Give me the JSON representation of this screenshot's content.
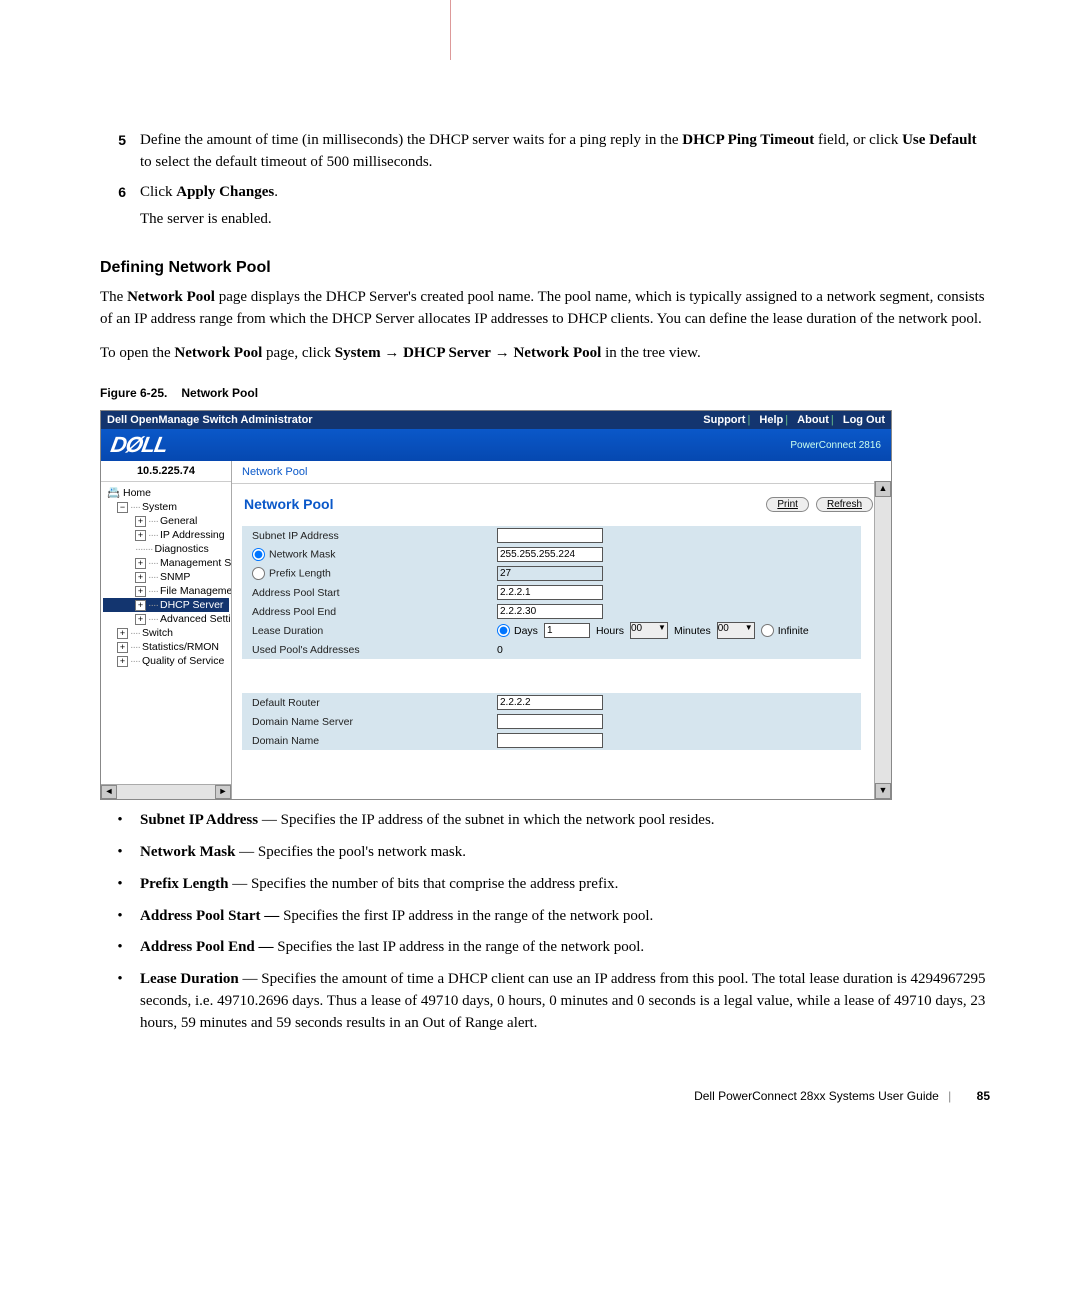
{
  "steps": {
    "s5": {
      "num": "5",
      "t1": "Define the amount of time (in milliseconds) the DHCP server waits for a ping reply in the ",
      "b1": "DHCP Ping Timeout",
      "t2": " field, or click ",
      "b2": "Use Default",
      "t3": " to select the default timeout of 500 milliseconds."
    },
    "s6": {
      "num": "6",
      "t1": "Click ",
      "b1": "Apply Changes",
      "t2": ".",
      "after": "The server is enabled."
    }
  },
  "h3": "Defining Network Pool",
  "para1": {
    "t1": "The ",
    "b1": "Network Pool",
    "t2": " page displays the DHCP Server's created pool name. The pool name, which is typically assigned to a network segment, consists of an IP address range from which the DHCP Server allocates IP addresses to DHCP clients. You can define the lease duration of the network pool."
  },
  "para2": {
    "t1": "To open the ",
    "b1": "Network Pool",
    "t2": " page, click ",
    "b2": "System",
    "arr1": " → ",
    "b3": "DHCP Server",
    "arr2": " → ",
    "b4": "Network Pool",
    "t3": " in the tree view."
  },
  "figcap": {
    "a": "Figure 6-25.",
    "b": "Network Pool"
  },
  "shot": {
    "titlebar": "Dell OpenManage Switch Administrator",
    "links": {
      "support": "Support",
      "help": "Help",
      "about": "About",
      "logout": "Log Out"
    },
    "logo": "DØLL",
    "model": "PowerConnect 2816",
    "ip": "10.5.225.74",
    "crumb": "Network Pool",
    "mtitle": "Network Pool",
    "btn_print": "Print",
    "btn_refresh": "Refresh",
    "tree": {
      "home": "Home",
      "system": "System",
      "general": "General",
      "ipaddr": "IP Addressing",
      "diag": "Diagnostics",
      "mgmt": "Management Se",
      "snmp": "SNMP",
      "filemgr": "File Managemer",
      "dhcp": "DHCP Server",
      "adv": "Advanced Settin",
      "switch": "Switch",
      "stats": "Statistics/RMON",
      "qos": "Quality of Service"
    },
    "form": {
      "subnet_lab": "Subnet IP Address",
      "mask_lab": "Network Mask",
      "mask_val": "255.255.255.224",
      "prefix_lab": "Prefix Length",
      "prefix_val": "27",
      "start_lab": "Address Pool Start",
      "start_val": "2.2.2.1",
      "end_lab": "Address Pool End",
      "end_val": "2.2.2.30",
      "lease_lab": "Lease Duration",
      "days_lab": "Days",
      "days_val": "1",
      "hours_lab": "Hours",
      "hours_val": "00",
      "minutes_lab": "Minutes",
      "minutes_val": "00",
      "infinite_lab": "Infinite",
      "used_lab": "Used Pool's Addresses",
      "used_val": "0",
      "router_lab": "Default Router",
      "router_val": "2.2.2.2",
      "dns_lab": "Domain Name Server",
      "domain_lab": "Domain Name"
    }
  },
  "bullets": {
    "b1": {
      "term": "Subnet IP Address",
      "txt": " — Specifies the IP address of the subnet in which the network pool resides."
    },
    "b2": {
      "term": "Network Mask",
      "txt": " — Specifies the pool's network mask."
    },
    "b3": {
      "term": "Prefix Length",
      "txt": " — Specifies the number of bits that comprise the address prefix."
    },
    "b4": {
      "term": "Address Pool Start —",
      "txt": " Specifies the first IP address in the range of the network pool."
    },
    "b5": {
      "term": "Address Pool End —",
      "txt": " Specifies the last IP address in the range of the network pool."
    },
    "b6": {
      "term": "Lease Duration",
      "txt": " — Specifies the amount of time a DHCP client can use an IP address from this pool. The total lease duration is 4294967295 seconds, i.e. 49710.2696 days. Thus a lease of 49710 days, 0 hours, 0 minutes and 0 seconds is a legal value, while a lease of 49710 days, 23 hours, 59 minutes and 59 seconds results in an Out of Range alert."
    }
  },
  "footer": {
    "title": "Dell PowerConnect 28xx Systems User Guide",
    "page": "85"
  }
}
